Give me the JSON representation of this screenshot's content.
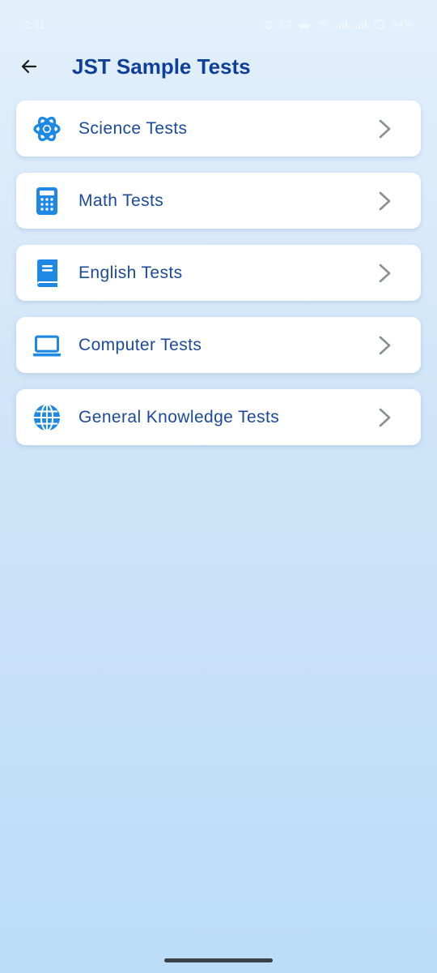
{
  "status_bar": {
    "time": "2:31",
    "battery": "94%"
  },
  "header": {
    "title": "JST Sample Tests"
  },
  "categories": [
    {
      "label": "Science Tests",
      "icon": "atom-icon"
    },
    {
      "label": "Math Tests",
      "icon": "calculator-icon"
    },
    {
      "label": "English Tests",
      "icon": "book-icon"
    },
    {
      "label": "Computer Tests",
      "icon": "laptop-icon"
    },
    {
      "label": "General Knowledge Tests",
      "icon": "globe-icon"
    }
  ],
  "colors": {
    "title": "#103f9a",
    "label": "#1b4a9a",
    "icon": "#1e88e5",
    "chevron": "#8a8f96",
    "card": "#ffffff"
  }
}
